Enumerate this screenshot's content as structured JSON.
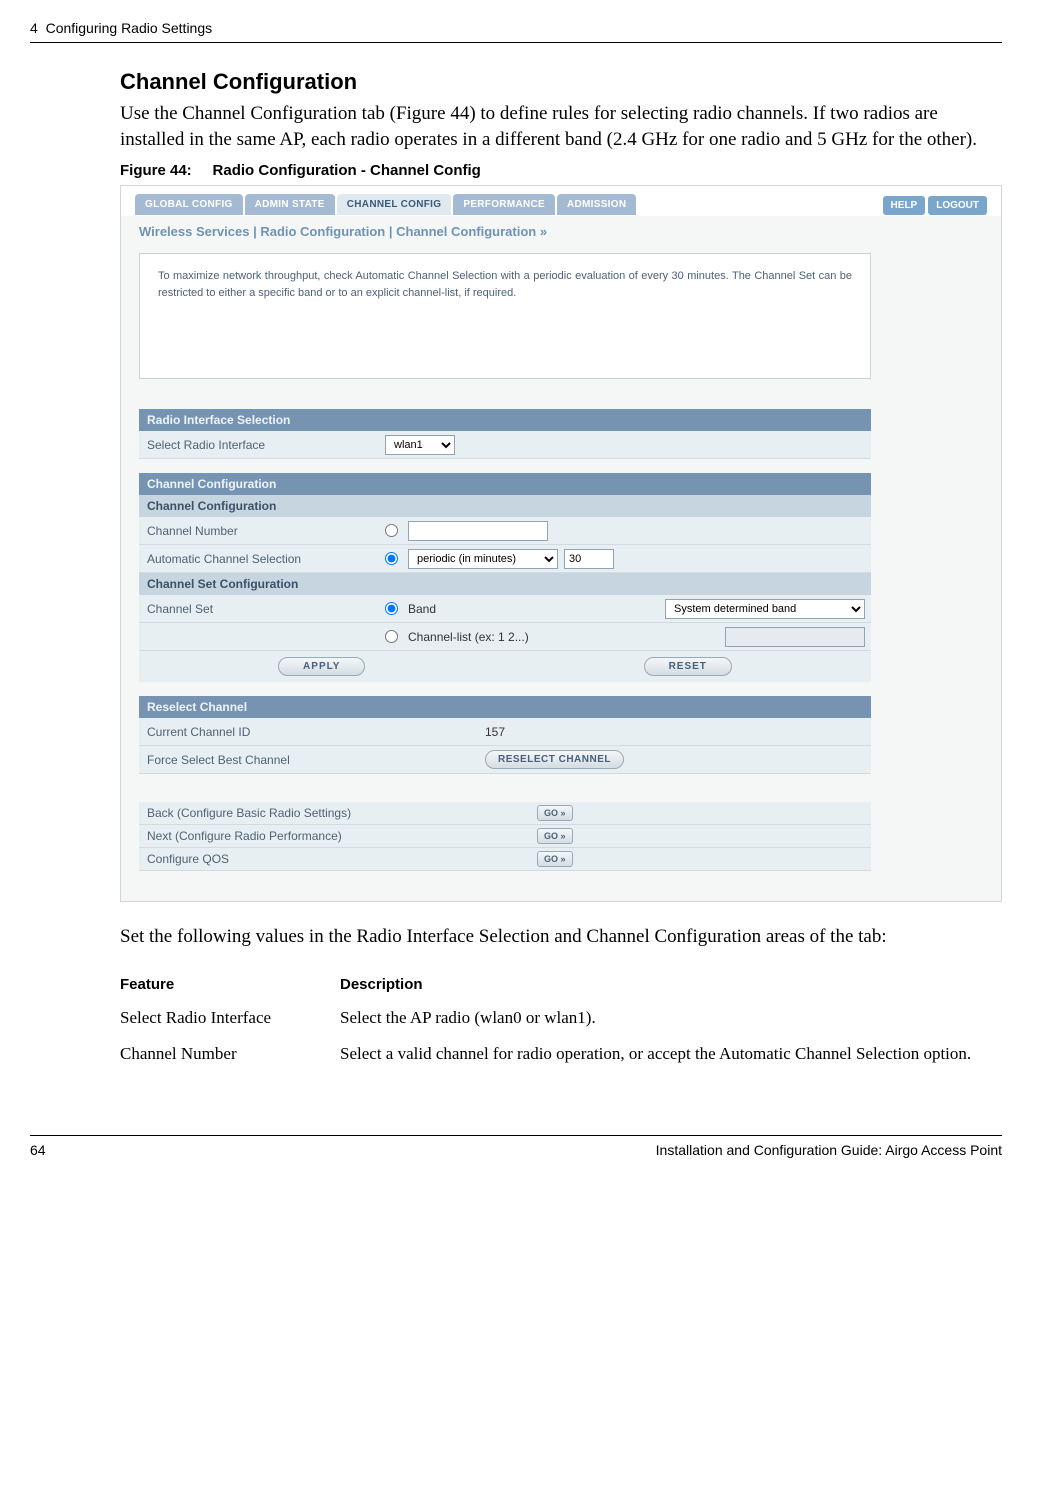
{
  "header": {
    "chapter": "4",
    "title": "Configuring Radio Settings"
  },
  "section_heading": "Channel Configuration",
  "intro_paragraph": "Use the Channel Configuration tab (Figure 44) to define rules for selecting radio channels. If two radios are installed in the same AP, each radio operates in a different band (2.4 GHz for one radio and 5 GHz for the other).",
  "figure_caption_prefix": "Figure 44:",
  "figure_caption_text": "Radio Configuration - Channel Config",
  "screenshot": {
    "tabs": {
      "global": "GLOBAL CONFIG",
      "admin": "ADMIN STATE",
      "channel": "CHANNEL CONFIG",
      "perf": "PERFORMANCE",
      "adm": "ADMISSION"
    },
    "help": "HELP",
    "logout": "LOGOUT",
    "breadcrumb": "Wireless Services | Radio Configuration | Channel Configuration  »",
    "infobox": "To maximize network throughput, check Automatic Channel Selection with a periodic evaluation of every 30 minutes. The Channel Set can be restricted to either a specific band or to an explicit channel-list, if required.",
    "radio_if": {
      "title": "Radio Interface Selection",
      "label": "Select Radio Interface",
      "value": "wlan1"
    },
    "chan_conf": {
      "title": "Channel Configuration",
      "sub": "Channel Configuration",
      "number_label": "Channel Number",
      "auto_label": "Automatic Channel Selection",
      "auto_select": "periodic (in minutes)",
      "auto_value": "30",
      "set_sub": "Channel Set Configuration",
      "set_label": "Channel Set",
      "band_label": "Band",
      "band_select": "System determined band",
      "list_label": "Channel-list (ex: 1 2...)"
    },
    "apply_btn": "APPLY",
    "reset_btn": "RESET",
    "reselect": {
      "title": "Reselect Channel",
      "curr_label": "Current Channel ID",
      "curr_value": "157",
      "force_label": "Force Select Best Channel",
      "btn": "RESELECT CHANNEL"
    },
    "nav": {
      "back": "Back (Configure Basic Radio Settings)",
      "next": "Next (Configure Radio Performance)",
      "qos": "Configure QOS",
      "go": "GO »"
    }
  },
  "after_paragraph": "Set the following values in the Radio Interface Selection and Channel Configuration areas of the tab:",
  "table": {
    "h1": "Feature",
    "h2": "Description",
    "r1c1": "Select Radio Interface",
    "r1c2": "Select the AP radio (wlan0 or wlan1).",
    "r2c1": "Channel Number",
    "r2c2": "Select a valid channel for radio operation, or accept the Automatic Channel Selection option."
  },
  "footer": {
    "page": "64",
    "title": "Installation and Configuration Guide: Airgo Access Point"
  }
}
